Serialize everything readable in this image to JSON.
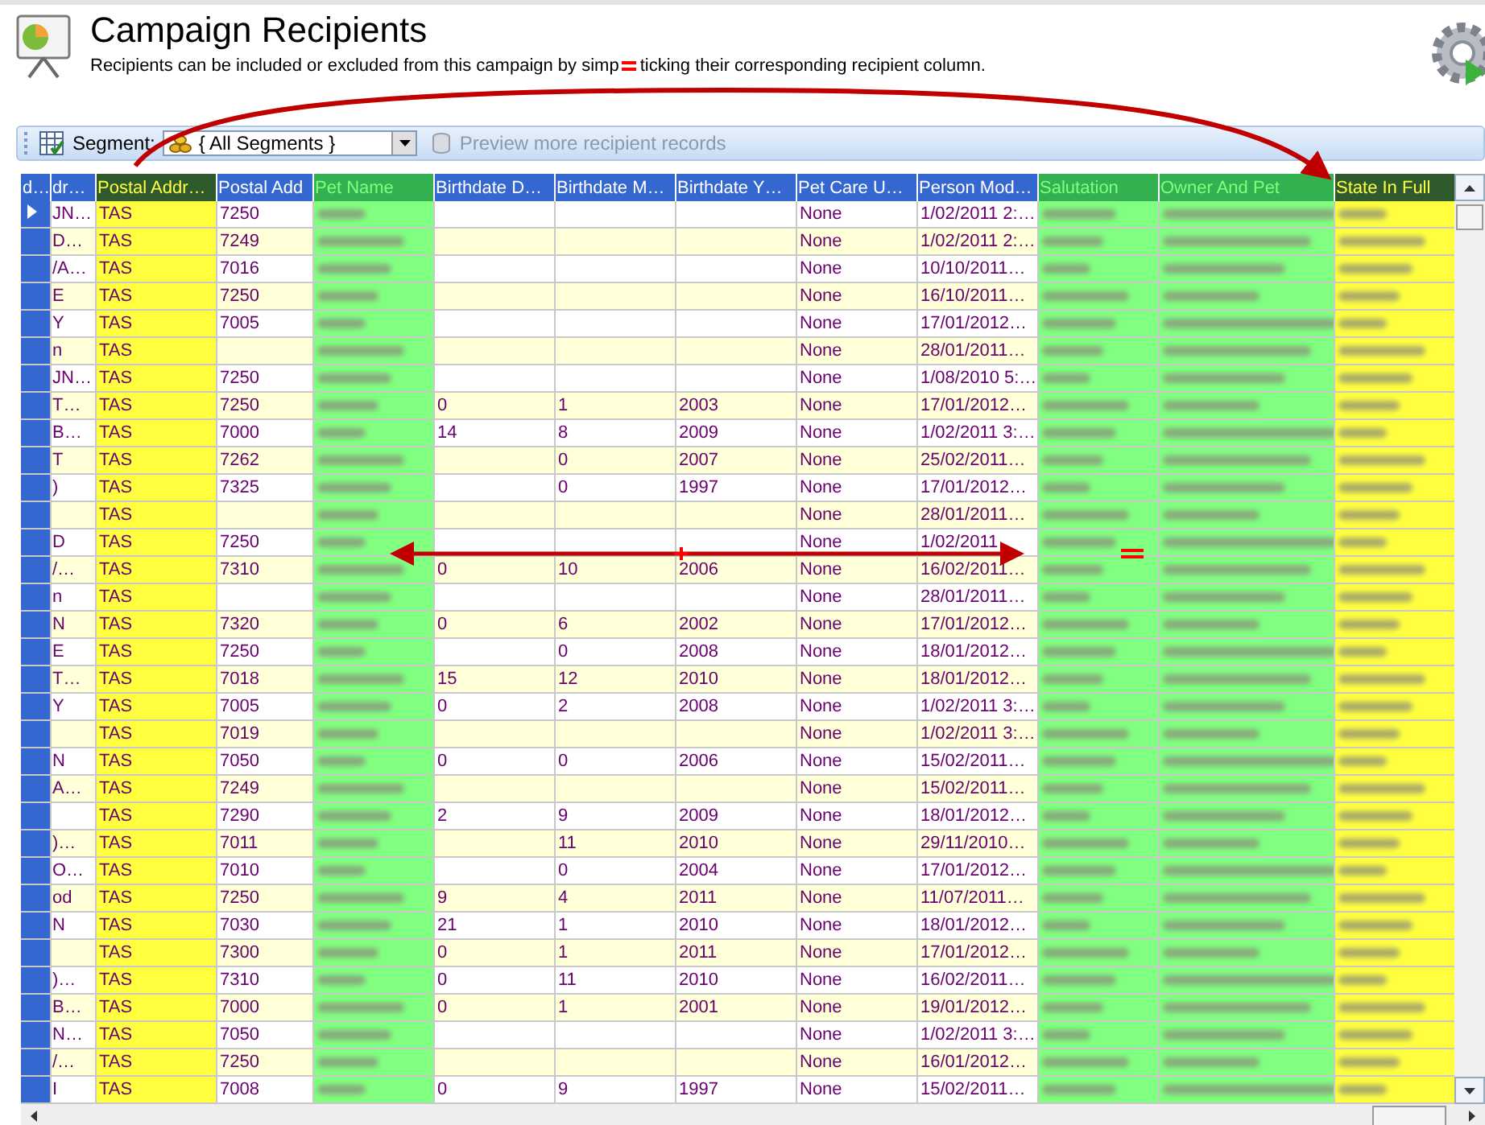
{
  "header": {
    "title": "Campaign Recipients",
    "subtitle_before_mark": "Recipients can be included or excluded from this campaign by simp",
    "subtitle_after_mark": "ticking their corresponding recipient column."
  },
  "toolbar": {
    "segment_label": "Segment:",
    "segment_value": "{ All Segments }",
    "preview_button": {
      "label": "Preview more recipient records",
      "disabled": true
    }
  },
  "table": {
    "columns": [
      {
        "label": "d…",
        "kind": "rowheader"
      },
      {
        "label": "dr…",
        "kind": "text"
      },
      {
        "label": "Postal Addr…",
        "kind": "text",
        "color": "#ffff40"
      },
      {
        "label": "Postal Add",
        "kind": "text"
      },
      {
        "label": "Pet Name",
        "kind": "blurred",
        "color": "#80ff80"
      },
      {
        "label": "Birthdate D…",
        "kind": "text"
      },
      {
        "label": "Birthdate M…",
        "kind": "text"
      },
      {
        "label": "Birthdate Y…",
        "kind": "text"
      },
      {
        "label": "Pet Care U…",
        "kind": "text"
      },
      {
        "label": "Person Mod…",
        "kind": "text"
      },
      {
        "label": "Salutation",
        "kind": "blurred",
        "color": "#80ff80"
      },
      {
        "label": "Owner And Pet",
        "kind": "blurred",
        "color": "#80ff80"
      },
      {
        "label": "State In Full",
        "kind": "blurred",
        "color": "#ffff40"
      }
    ],
    "rows": [
      {
        "selected": true,
        "cells": [
          null,
          "JN…",
          "TAS",
          "7250",
          null,
          null,
          null,
          null,
          "None",
          "1/02/2011 2:…",
          null,
          null,
          null
        ]
      },
      {
        "selected": false,
        "cells": [
          null,
          "D…",
          "TAS",
          "7249",
          null,
          null,
          null,
          null,
          "None",
          "1/02/2011 2:…",
          null,
          null,
          null
        ]
      },
      {
        "selected": false,
        "cells": [
          null,
          "/A…",
          "TAS",
          "7016",
          null,
          null,
          null,
          null,
          "None",
          "10/10/2011…",
          null,
          null,
          null
        ]
      },
      {
        "selected": false,
        "cells": [
          null,
          "E",
          "TAS",
          "7250",
          null,
          null,
          null,
          null,
          "None",
          "16/10/2011…",
          null,
          null,
          null
        ]
      },
      {
        "selected": false,
        "cells": [
          null,
          "Y",
          "TAS",
          "7005",
          null,
          null,
          null,
          null,
          "None",
          "17/01/2012…",
          null,
          null,
          null
        ]
      },
      {
        "selected": false,
        "cells": [
          null,
          "n",
          "TAS",
          null,
          null,
          null,
          null,
          null,
          "None",
          "28/01/2011…",
          null,
          null,
          null
        ]
      },
      {
        "selected": false,
        "cells": [
          null,
          "JN…",
          "TAS",
          "7250",
          null,
          null,
          null,
          null,
          "None",
          "1/08/2010 5:…",
          null,
          null,
          null
        ]
      },
      {
        "selected": false,
        "cells": [
          null,
          "T…",
          "TAS",
          "7250",
          null,
          "0",
          "1",
          "2003",
          "None",
          "17/01/2012…",
          null,
          null,
          null
        ]
      },
      {
        "selected": false,
        "cells": [
          null,
          "B…",
          "TAS",
          "7000",
          null,
          "14",
          "8",
          "2009",
          "None",
          "1/02/2011 3:…",
          null,
          null,
          null
        ]
      },
      {
        "selected": false,
        "cells": [
          null,
          "T",
          "TAS",
          "7262",
          null,
          null,
          "0",
          "2007",
          "None",
          "25/02/2011…",
          null,
          null,
          null
        ]
      },
      {
        "selected": false,
        "cells": [
          null,
          ")",
          "TAS",
          "7325",
          null,
          null,
          "0",
          "1997",
          "None",
          "17/01/2012…",
          null,
          null,
          null
        ]
      },
      {
        "selected": false,
        "cells": [
          null,
          null,
          "TAS",
          null,
          null,
          null,
          null,
          null,
          "None",
          "28/01/2011…",
          null,
          null,
          null
        ]
      },
      {
        "selected": false,
        "cells": [
          null,
          "D",
          "TAS",
          "7250",
          null,
          null,
          null,
          null,
          "None",
          "1/02/2011",
          null,
          null,
          null
        ]
      },
      {
        "selected": false,
        "cells": [
          null,
          "/…",
          "TAS",
          "7310",
          null,
          "0",
          "10",
          "2006",
          "None",
          "16/02/2011…",
          null,
          null,
          null
        ]
      },
      {
        "selected": false,
        "cells": [
          null,
          "n",
          "TAS",
          null,
          null,
          null,
          null,
          null,
          "None",
          "28/01/2011…",
          null,
          null,
          null
        ]
      },
      {
        "selected": false,
        "cells": [
          null,
          "N",
          "TAS",
          "7320",
          null,
          "0",
          "6",
          "2002",
          "None",
          "17/01/2012…",
          null,
          null,
          null
        ]
      },
      {
        "selected": false,
        "cells": [
          null,
          "E",
          "TAS",
          "7250",
          null,
          null,
          "0",
          "2008",
          "None",
          "18/01/2012…",
          null,
          null,
          null
        ]
      },
      {
        "selected": false,
        "cells": [
          null,
          "T…",
          "TAS",
          "7018",
          null,
          "15",
          "12",
          "2010",
          "None",
          "18/01/2012…",
          null,
          null,
          null
        ]
      },
      {
        "selected": false,
        "cells": [
          null,
          "Y",
          "TAS",
          "7005",
          null,
          "0",
          "2",
          "2008",
          "None",
          "1/02/2011 3:…",
          null,
          null,
          null
        ]
      },
      {
        "selected": false,
        "cells": [
          null,
          null,
          "TAS",
          "7019",
          null,
          null,
          null,
          null,
          "None",
          "1/02/2011 3:…",
          null,
          null,
          null
        ]
      },
      {
        "selected": false,
        "cells": [
          null,
          "N",
          "TAS",
          "7050",
          null,
          "0",
          "0",
          "2006",
          "None",
          "15/02/2011…",
          null,
          null,
          null
        ]
      },
      {
        "selected": false,
        "cells": [
          null,
          "A…",
          "TAS",
          "7249",
          null,
          null,
          null,
          null,
          "None",
          "15/02/2011…",
          null,
          null,
          null
        ]
      },
      {
        "selected": false,
        "cells": [
          null,
          null,
          "TAS",
          "7290",
          null,
          "2",
          "9",
          "2009",
          "None",
          "18/01/2012…",
          null,
          null,
          null
        ]
      },
      {
        "selected": false,
        "cells": [
          null,
          ")…",
          "TAS",
          "7011",
          null,
          null,
          "11",
          "2010",
          "None",
          "29/11/2010…",
          null,
          null,
          null
        ]
      },
      {
        "selected": false,
        "cells": [
          null,
          "O…",
          "TAS",
          "7010",
          null,
          null,
          "0",
          "2004",
          "None",
          "17/01/2012…",
          null,
          null,
          null
        ]
      },
      {
        "selected": false,
        "cells": [
          null,
          "od",
          "TAS",
          "7250",
          null,
          "9",
          "4",
          "2011",
          "None",
          "11/07/2011…",
          null,
          null,
          null
        ]
      },
      {
        "selected": false,
        "cells": [
          null,
          "N",
          "TAS",
          "7030",
          null,
          "21",
          "1",
          "2010",
          "None",
          "18/01/2012…",
          null,
          null,
          null
        ]
      },
      {
        "selected": false,
        "cells": [
          null,
          null,
          "TAS",
          "7300",
          null,
          "0",
          "1",
          "2011",
          "None",
          "17/01/2012…",
          null,
          null,
          null
        ]
      },
      {
        "selected": false,
        "cells": [
          null,
          ")…",
          "TAS",
          "7310",
          null,
          "0",
          "11",
          "2010",
          "None",
          "16/02/2011…",
          null,
          null,
          null
        ]
      },
      {
        "selected": false,
        "cells": [
          null,
          "B…",
          "TAS",
          "7000",
          null,
          "0",
          "1",
          "2001",
          "None",
          "19/01/2012…",
          null,
          null,
          null
        ]
      },
      {
        "selected": false,
        "cells": [
          null,
          "N…",
          "TAS",
          "7050",
          null,
          null,
          null,
          null,
          "None",
          "1/02/2011 3:…",
          null,
          null,
          null
        ]
      },
      {
        "selected": false,
        "cells": [
          null,
          "/…",
          "TAS",
          "7250",
          null,
          null,
          null,
          null,
          "None",
          "16/01/2012…",
          null,
          null,
          null
        ]
      },
      {
        "selected": false,
        "cells": [
          null,
          "I",
          "TAS",
          "7008",
          null,
          "0",
          "9",
          "1997",
          "None",
          "15/02/2011…",
          null,
          null,
          null
        ]
      }
    ]
  }
}
